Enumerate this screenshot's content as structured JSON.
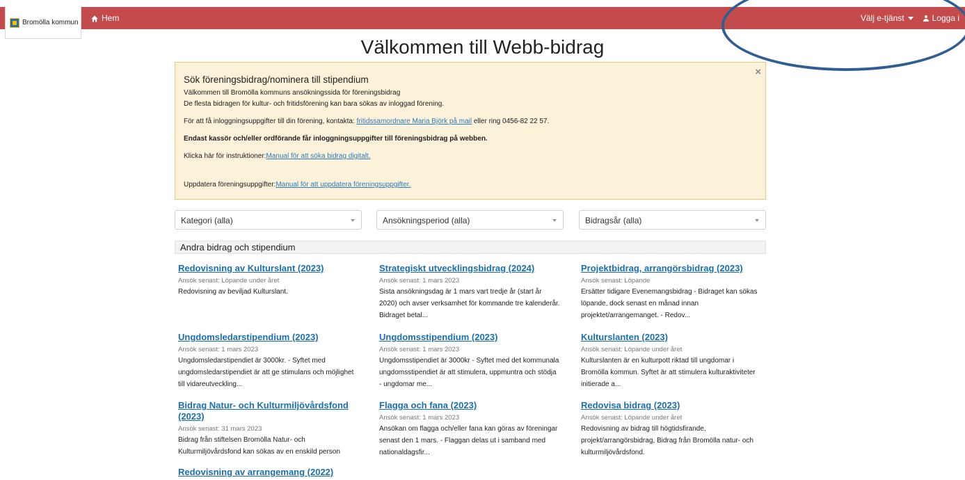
{
  "nav": {
    "brand": "Bromölla kommun",
    "home_label": "Hem",
    "eservice_label": "Välj e-tjänst",
    "login_label": "Logga i"
  },
  "page": {
    "title": "Välkommen till Webb-bidrag"
  },
  "alert": {
    "close_symbol": "×",
    "heading": "Sök föreningsbidrag/nominera till stipendium",
    "line1": "Välkommen till Bromölla kommuns ansökningssida för föreningsbidrag",
    "line2": "De flesta bidragen för kultur- och fritidsförening kan bara sökas av inloggad förening.",
    "contact_prefix": "För att få inloggningsuppgifter till din förening, kontakta: ",
    "contact_link": "fritidssamordnare Maria Björk på mail",
    "contact_suffix": " eller ring 0456-82 22 57.",
    "bold_line": "Endast kassör och/eller ordförande får inloggningsuppgifter till föreningsbidrag på webben.",
    "manual_prefix": "Klicka här för instruktioner:",
    "manual_link": "Manual för att söka bidrag digitalt.",
    "update_prefix": "Uppdatera föreningsuppgifter:",
    "update_link": "Manual för att uppdatera föreningsuppgifter."
  },
  "filters": {
    "category": "Kategori (alla)",
    "period": "Ansökningsperiod (alla)",
    "year": "Bidragsår (alla)"
  },
  "section": {
    "title": "Andra bidrag och stipendium"
  },
  "grants": [
    {
      "title": "Redovisning av Kulturslant (2023)",
      "meta": "Ansök senast: Löpande under året",
      "desc": "Redovisning av beviljad Kulturslant."
    },
    {
      "title": "Strategiskt utvecklingsbidrag (2024)",
      "meta": "Ansök senast: 1 mars 2023",
      "desc": "Sista ansökningsdag är 1 mars vart tredje år (start år 2020) och avser verksamhet för kommande tre kalenderår. Bidraget betal..."
    },
    {
      "title": "Projektbidrag, arrangörsbidrag (2023)",
      "meta": "Ansök senast: Löpande",
      "desc": "Ersätter tidigare Evenemangsbidrag - Bidraget kan sökas löpande, dock senast en månad innan projektet/arrangemanget. - Redov..."
    },
    {
      "title": "Ungdomsledarstipendium (2023)",
      "meta": "Ansök senast: 1 mars 2023",
      "desc": "Ungdomsledarstipendiet är 3000kr. - Syftet med ungdomsledarstipendiet är att ge stimulans och möjlighet till vidareutveckling..."
    },
    {
      "title": "Ungdomsstipendium (2023)",
      "meta": "Ansök senast: 1 mars 2023",
      "desc": "Ungdomsstipendiet är 3000kr - Syftet med det kommunala ungdomsstipendiet är att stimulera, uppmuntra och stödja - ungdomar me..."
    },
    {
      "title": "Kulturslanten (2023)",
      "meta": "Ansök senast: Löpande under året",
      "desc": "Kulturslanten är en kulturpott riktad till ungdomar i Bromölla kommun. Syftet är att stimulera kulturaktiviteter initierade a..."
    },
    {
      "title": "Bidrag Natur- och Kulturmiljövårdsfond (2023)",
      "meta": "Ansök senast: 31 mars 2023",
      "desc": "Bidrag från stiftelsen Bromölla Natur- och Kulturmiljövårdsfond kan sökas av en enskild person"
    },
    {
      "title": "Flagga och fana (2023)",
      "meta": "Ansök senast: 1 mars 2023",
      "desc": "Ansökan om flagga och/eller fana kan göras av föreningar senast den 1 mars. - Flaggan delas ut i samband med nationaldagsfir..."
    },
    {
      "title": "Redovisa bidrag (2023)",
      "meta": "Ansök senast: Löpande under året",
      "desc": "Redovisning av bidrag till högtidsfirande, projekt/arrangörsbidrag, Bidrag från Bromölla natur- och kulturmiljövårdsfond."
    },
    {
      "title": "Redovisning av arrangemang (2022)",
      "meta": "",
      "desc": ""
    }
  ]
}
